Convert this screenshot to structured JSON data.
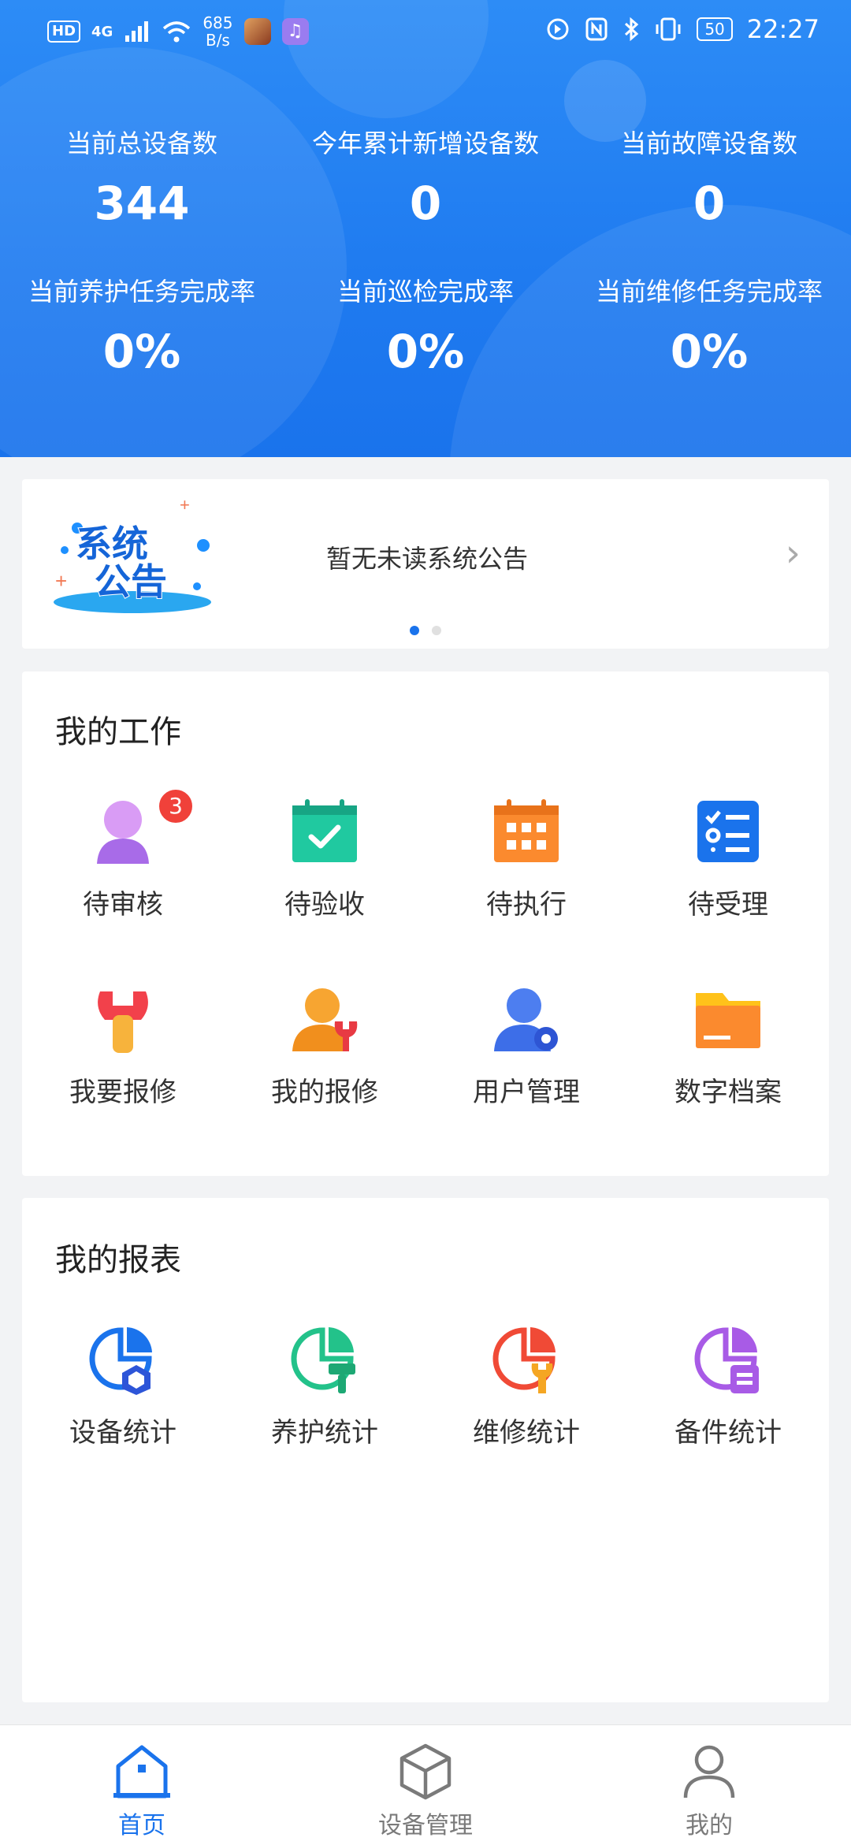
{
  "status_bar": {
    "hd": "HD",
    "network": "4G",
    "speed_value": "685",
    "speed_unit": "B/s",
    "battery": "50",
    "time": "22:27"
  },
  "stats": [
    {
      "label": "当前总设备数",
      "value": "344"
    },
    {
      "label": "今年累计新增设备数",
      "value": "0"
    },
    {
      "label": "当前故障设备数",
      "value": "0"
    },
    {
      "label": "当前养护任务完成率",
      "value": "0%"
    },
    {
      "label": "当前巡检完成率",
      "value": "0%"
    },
    {
      "label": "当前维修任务完成率",
      "value": "0%"
    }
  ],
  "notice": {
    "logo_text": "系统公告",
    "message": "暂无未读系统公告"
  },
  "my_work": {
    "title": "我的工作",
    "items": [
      {
        "label": "待审核",
        "icon": "reviewer-icon",
        "badge": "3"
      },
      {
        "label": "待验收",
        "icon": "calendar-check-icon"
      },
      {
        "label": "待执行",
        "icon": "calendar-grid-icon"
      },
      {
        "label": "待受理",
        "icon": "checklist-icon"
      },
      {
        "label": "我要报修",
        "icon": "wrench-icon"
      },
      {
        "label": "我的报修",
        "icon": "user-wrench-icon"
      },
      {
        "label": "用户管理",
        "icon": "user-gear-icon"
      },
      {
        "label": "数字档案",
        "icon": "folder-icon"
      }
    ]
  },
  "my_reports": {
    "title": "我的报表",
    "items": [
      {
        "label": "设备统计",
        "icon": "pie-cube-icon"
      },
      {
        "label": "养护统计",
        "icon": "pie-brush-icon"
      },
      {
        "label": "维修统计",
        "icon": "pie-wrench-icon"
      },
      {
        "label": "备件统计",
        "icon": "pie-spare-icon"
      }
    ]
  },
  "bottom_nav": [
    {
      "label": "首页",
      "icon": "home-icon",
      "active": true
    },
    {
      "label": "设备管理",
      "icon": "cube-icon",
      "active": false
    },
    {
      "label": "我的",
      "icon": "profile-icon",
      "active": false
    }
  ],
  "colors": {
    "primary": "#1a73ec",
    "badge": "#f0413a"
  }
}
